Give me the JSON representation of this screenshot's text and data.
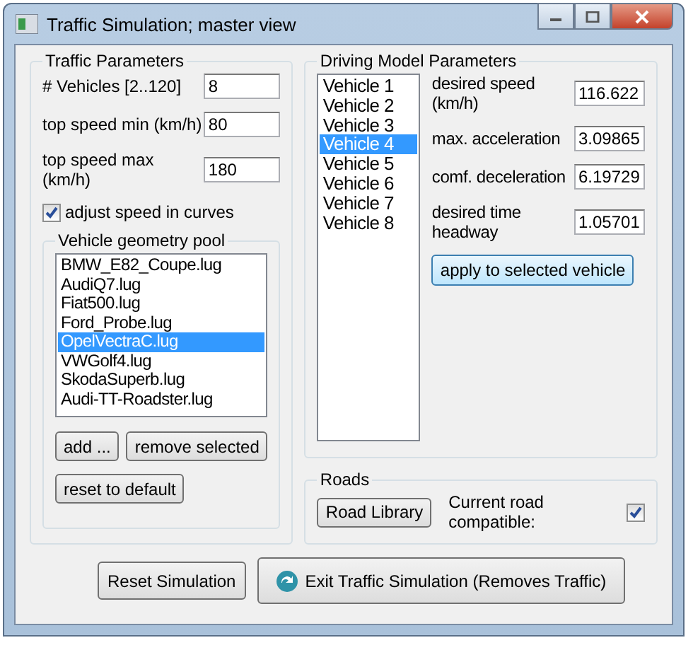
{
  "window": {
    "title": "Traffic Simulation; master view"
  },
  "traffic_parameters": {
    "title": "Traffic Parameters",
    "fields": [
      {
        "label": "# Vehicles [2..120]",
        "value": "8"
      },
      {
        "label": "top speed min (km/h)",
        "value": "80"
      },
      {
        "label": "top speed max (km/h)",
        "value": "180"
      }
    ],
    "adjust_speed": {
      "label": "adjust speed in curves",
      "checked": true
    }
  },
  "geometry_pool": {
    "title": "Vehicle geometry pool",
    "items": [
      {
        "label": "BMW_E82_Coupe.lug",
        "selected": false
      },
      {
        "label": "AudiQ7.lug",
        "selected": false
      },
      {
        "label": "Fiat500.lug",
        "selected": false
      },
      {
        "label": "Ford_Probe.lug",
        "selected": false
      },
      {
        "label": "OpelVectraC.lug",
        "selected": true
      },
      {
        "label": "VWGolf4.lug",
        "selected": false
      },
      {
        "label": "SkodaSuperb.lug",
        "selected": false
      },
      {
        "label": "Audi-TT-Roadster.lug",
        "selected": false
      }
    ],
    "add_button": "add ...",
    "remove_button": "remove selected",
    "reset_button": "reset to default"
  },
  "driving_model": {
    "title": "Driving Model Parameters",
    "vehicles": [
      {
        "label": "Vehicle 1",
        "selected": false
      },
      {
        "label": "Vehicle 2",
        "selected": false
      },
      {
        "label": "Vehicle 3",
        "selected": false
      },
      {
        "label": "Vehicle 4",
        "selected": true
      },
      {
        "label": "Vehicle 5",
        "selected": false
      },
      {
        "label": "Vehicle 6",
        "selected": false
      },
      {
        "label": "Vehicle 7",
        "selected": false
      },
      {
        "label": "Vehicle 8",
        "selected": false
      }
    ],
    "params": [
      {
        "label": "desired speed (km/h)",
        "value": "116.622"
      },
      {
        "label": "max. acceleration",
        "value": "3.09865"
      },
      {
        "label": "comf. deceleration",
        "value": "6.19729"
      },
      {
        "label": "desired time headway",
        "value": "1.05701"
      }
    ],
    "apply_button": "apply to selected vehicle"
  },
  "roads": {
    "title": "Roads",
    "library_button": "Road Library",
    "compatible": {
      "label": "Current road compatible:",
      "checked": true
    }
  },
  "reset_simulation_button": "Reset Simulation",
  "exit_button": "Exit Traffic Simulation (Removes Traffic)"
}
